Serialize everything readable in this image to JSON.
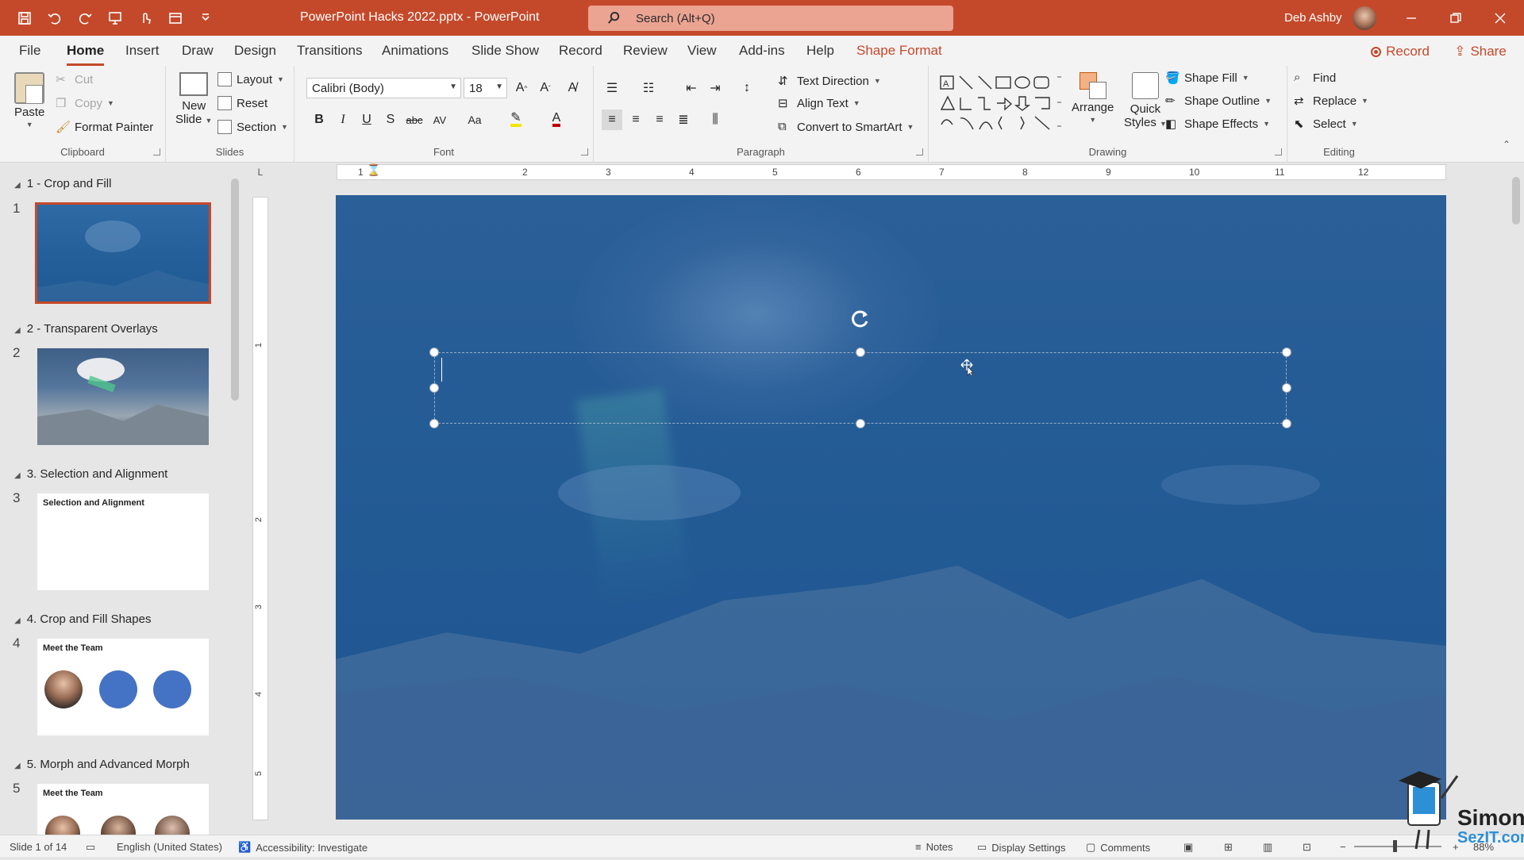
{
  "window": {
    "doc_title": "PowerPoint Hacks 2022.pptx  -  PowerPoint",
    "search_placeholder": "Search (Alt+Q)",
    "user_name": "Deb Ashby"
  },
  "tabs": [
    "File",
    "Home",
    "Insert",
    "Draw",
    "Design",
    "Transitions",
    "Animations",
    "Slide Show",
    "Record",
    "Review",
    "View",
    "Add-ins",
    "Help",
    "Shape Format"
  ],
  "header_buttons": {
    "record": "Record",
    "share": "Share"
  },
  "ribbon": {
    "clipboard": {
      "label": "Clipboard",
      "paste": "Paste",
      "cut": "Cut",
      "copy": "Copy",
      "format_painter": "Format Painter"
    },
    "slides": {
      "label": "Slides",
      "new_slide_1": "New",
      "new_slide_2": "Slide",
      "layout": "Layout",
      "reset": "Reset",
      "section": "Section"
    },
    "font": {
      "label": "Font",
      "family": "Calibri (Body)",
      "size": "18"
    },
    "paragraph": {
      "label": "Paragraph",
      "text_direction": "Text Direction",
      "align_text": "Align Text",
      "convert": "Convert to SmartArt"
    },
    "drawing": {
      "label": "Drawing",
      "arrange": "Arrange",
      "quick_1": "Quick",
      "quick_2": "Styles",
      "shape_fill": "Shape Fill",
      "shape_outline": "Shape Outline",
      "shape_effects": "Shape Effects"
    },
    "editing": {
      "label": "Editing",
      "find": "Find",
      "replace": "Replace",
      "select": "Select"
    }
  },
  "ruler_h": [
    "1",
    "1",
    "2",
    "3",
    "4",
    "5",
    "6",
    "7",
    "8",
    "9",
    "10",
    "11",
    "12"
  ],
  "ruler_v": [
    "1",
    "2",
    "3",
    "4",
    "5"
  ],
  "sections": [
    {
      "title": "1 - Crop and Fill",
      "num": "1"
    },
    {
      "title": "2 - Transparent Overlays",
      "num": "2"
    },
    {
      "title": "3. Selection and Alignment",
      "num": "3",
      "thumb_title": "Selection and Alignment"
    },
    {
      "title": "4. Crop and Fill Shapes",
      "num": "4",
      "thumb_title": "Meet the Team"
    },
    {
      "title": "5. Morph and Advanced Morph",
      "num": "5",
      "thumb_title": "Meet the Team"
    }
  ],
  "status": {
    "slide": "Slide 1 of 14",
    "language": "English (United States)",
    "accessibility": "Accessibility: Investigate",
    "notes": "Notes",
    "display": "Display Settings",
    "comments": "Comments",
    "zoom": "88%"
  },
  "logo": {
    "line1": "Simon",
    "line2": "SezIT.com"
  },
  "colors": {
    "accent": "#c4492a",
    "slide": "#235b95",
    "ribbon": "#f3f3f3"
  }
}
